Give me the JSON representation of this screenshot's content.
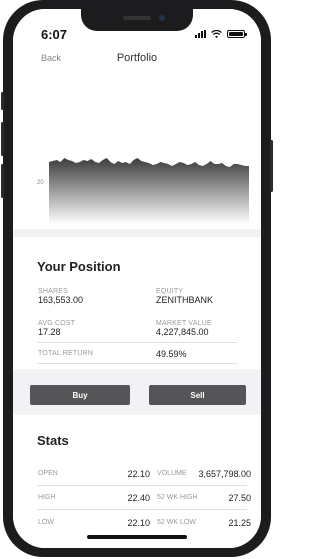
{
  "status_bar": {
    "time": "6:07"
  },
  "nav": {
    "back_label": "Back",
    "title": "Portfolio"
  },
  "chart_data": {
    "type": "area",
    "y_tick_label": "20",
    "values": [
      0.62,
      0.63,
      0.64,
      0.62,
      0.66,
      0.64,
      0.63,
      0.61,
      0.62,
      0.64,
      0.63,
      0.65,
      0.62,
      0.61,
      0.64,
      0.66,
      0.62,
      0.6,
      0.63,
      0.61,
      0.62,
      0.6,
      0.64,
      0.66,
      0.63,
      0.62,
      0.61,
      0.59,
      0.6,
      0.62,
      0.61,
      0.6,
      0.58,
      0.6,
      0.62,
      0.61,
      0.59,
      0.6,
      0.62,
      0.59,
      0.58,
      0.6,
      0.63,
      0.6,
      0.6,
      0.61,
      0.58,
      0.57,
      0.6,
      0.6,
      0.59,
      0.58,
      0.58
    ]
  },
  "position": {
    "title": "Your Position",
    "shares_label": "SHARES",
    "shares_value": "163,553.00",
    "equity_label": "EQUITY",
    "equity_value": "ZENITHBANK",
    "avg_cost_label": "AVG COST",
    "avg_cost_value": "17.28",
    "market_value_label": "MARKET VALUE",
    "market_value_value": "4,227,845.00",
    "total_return_label": "TOTAL RETURN",
    "total_return_value": "49.59%"
  },
  "actions": {
    "buy_label": "Buy",
    "sell_label": "Sell"
  },
  "stats": {
    "title": "Stats",
    "open_label": "OPEN",
    "open_value": "22.10",
    "volume_label": "VOLUME",
    "volume_value": "3,657,798.00",
    "high_label": "HIGH",
    "high_value": "22.40",
    "wk52_high_label": "52 WK HIGH",
    "wk52_high_value": "27.50",
    "low_label": "LOW",
    "low_value": "22.10",
    "wk52_low_label": "52 WK LOW",
    "wk52_low_value": "21.25"
  },
  "colors": {
    "button_bg": "#555558",
    "chart_top": "#3c3c3e",
    "chart_bottom": "#ffffff"
  }
}
